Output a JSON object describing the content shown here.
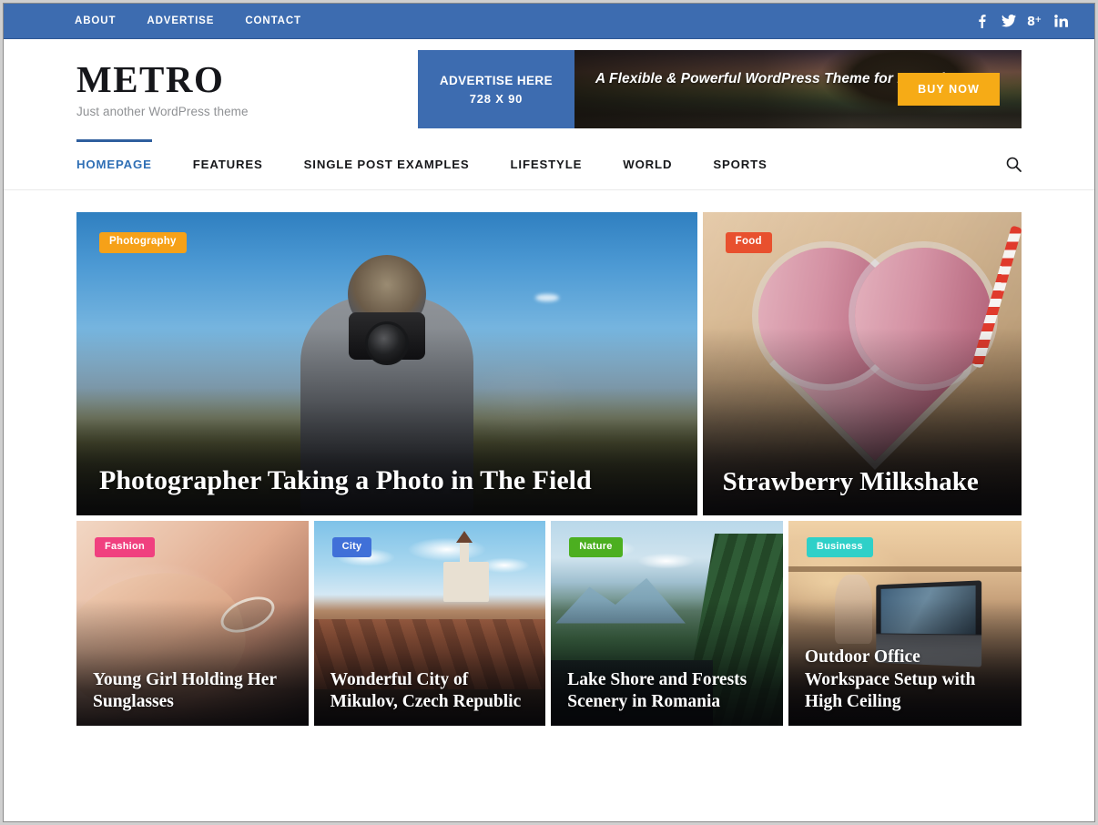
{
  "topbar": {
    "links": [
      {
        "label": "ABOUT"
      },
      {
        "label": "ADVERTISE"
      },
      {
        "label": "CONTACT"
      }
    ],
    "social": [
      {
        "name": "facebook-icon",
        "glyph": "f"
      },
      {
        "name": "twitter-icon",
        "glyph": "t"
      },
      {
        "name": "google-plus-icon",
        "glyph": "g+"
      },
      {
        "name": "linkedin-icon",
        "glyph": "in"
      }
    ],
    "bg_color": "#3d6cb0"
  },
  "brand": {
    "title": "METRO",
    "tagline": "Just another WordPress theme"
  },
  "ad": {
    "left_line1": "ADVERTISE HERE",
    "left_line2": "728 X 90",
    "headline": "A Flexible & Powerful WordPress Theme for Magazine",
    "button_label": "BUY NOW",
    "button_color": "#f6ab16",
    "left_bg_color": "#3d6cb0"
  },
  "nav": {
    "items": [
      {
        "label": "HOMEPAGE",
        "active": true
      },
      {
        "label": "FEATURES",
        "active": false
      },
      {
        "label": "SINGLE POST EXAMPLES",
        "active": false
      },
      {
        "label": "LIFESTYLE",
        "active": false
      },
      {
        "label": "WORLD",
        "active": false
      },
      {
        "label": "SPORTS",
        "active": false
      }
    ],
    "active_color": "#2f6fb5",
    "search_icon": "search-icon"
  },
  "featured": {
    "top_row": [
      {
        "badge": "Photography",
        "badge_color": "#f6a118",
        "title": "Photographer Taking a Photo in The Field"
      },
      {
        "badge": "Food",
        "badge_color": "#e8502e",
        "title": "Strawberry Milkshake"
      }
    ],
    "bottom_row": [
      {
        "badge": "Fashion",
        "badge_color": "#f0407f",
        "title": "Young Girl Holding Her Sunglasses"
      },
      {
        "badge": "City",
        "badge_color": "#4070d8",
        "title": "Wonderful City of Mikulov, Czech Republic"
      },
      {
        "badge": "Nature",
        "badge_color": "#4caf20",
        "title": "Lake Shore and Forests Scenery in Romania"
      },
      {
        "badge": "Business",
        "badge_color": "#2fd0c8",
        "title": "Outdoor Office Workspace Setup with High Ceiling"
      }
    ]
  }
}
